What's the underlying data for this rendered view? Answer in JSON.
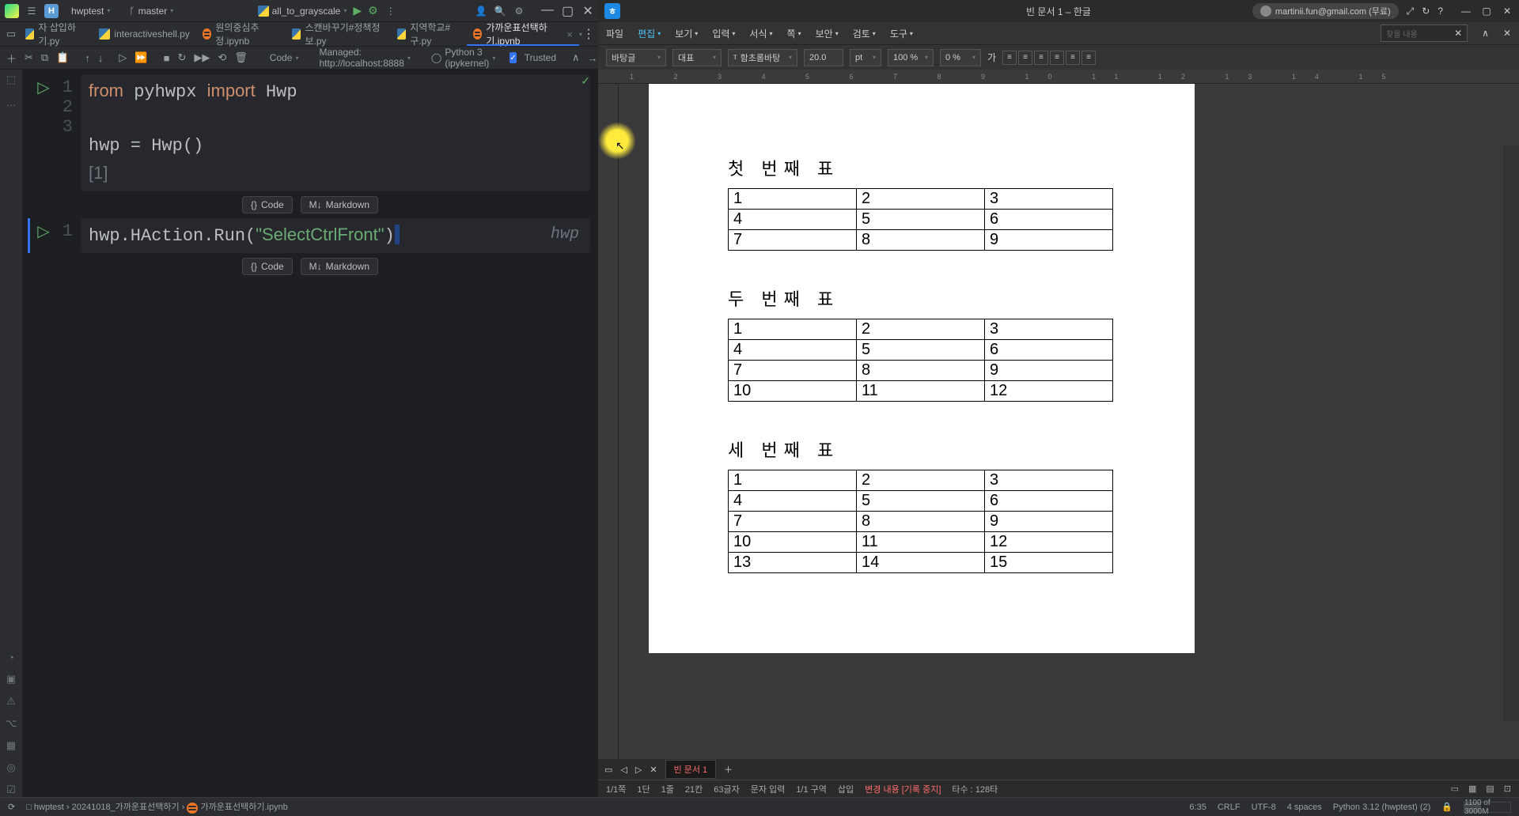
{
  "pycharm": {
    "project_badge": "H",
    "project_name": "hwptest",
    "branch": "master",
    "run_config": "all_to_grayscale",
    "tabs": [
      {
        "icon": "py",
        "label": "자 삽입하기.py"
      },
      {
        "icon": "py",
        "label": "interactiveshell.py"
      },
      {
        "icon": "jup",
        "label": "원의중심추정.ipynb"
      },
      {
        "icon": "py",
        "label": "스캔바꾸기#정책정보.py"
      },
      {
        "icon": "py",
        "label": "지역학교#구.py"
      },
      {
        "icon": "jup",
        "label": "가까운표선택하기.ipynb",
        "active": true
      }
    ],
    "nb_toolbar": {
      "code_label": "Code",
      "managed": "Managed: http://localhost:8888",
      "kernel": "Python 3 (ipykernel)",
      "trusted": "Trusted"
    },
    "cell1": {
      "lines": [
        {
          "n": "1",
          "tokens": [
            [
              "kw",
              "from"
            ],
            [
              "id",
              " pyhwpx "
            ],
            [
              "kw",
              "import"
            ],
            [
              "id",
              " Hwp"
            ]
          ]
        },
        {
          "n": "2",
          "tokens": []
        },
        {
          "n": "3",
          "tokens": [
            [
              "id",
              "hwp = Hwp()"
            ]
          ]
        }
      ],
      "out": "[1]"
    },
    "cell2": {
      "n": "1",
      "html": "hwp.HAction.Run(<span class='str'>\"SelectCtrlFront\"</span>)",
      "hint": "hwp"
    },
    "add": {
      "code": "Code",
      "md": "Markdown"
    },
    "status": {
      "path1": "hwptest",
      "path2": "20241018_가까운표선택하기",
      "path3": "가까운표선택하기.ipynb",
      "pos": "6:35",
      "eol": "CRLF",
      "enc": "UTF-8",
      "indent": "4 spaces",
      "interp": "Python 3.12 (hwptest) (2)",
      "mem": "1100 of 3000M"
    }
  },
  "hwp": {
    "title": "빈 문서 1 – 한글",
    "account": "martinii.fun@gmail.com (무료)",
    "menu": [
      "파일",
      "편집",
      "보기",
      "입력",
      "서식",
      "쪽",
      "보안",
      "검토",
      "도구"
    ],
    "menu_active_idx": 1,
    "format": {
      "style": "바탕글",
      "rep": "대표",
      "font": "함초롬바탕",
      "size": "20.0",
      "unit": "pt",
      "char_sp": "100 %",
      "line_sp": "0 %",
      "ga": "가"
    },
    "ruler": "1 2 3 4 5 6 7 8 9 10 11 12 13 14 15",
    "sections": [
      {
        "title": "첫 번째 표",
        "rows": [
          [
            "1",
            "2",
            "3"
          ],
          [
            "4",
            "5",
            "6"
          ],
          [
            "7",
            "8",
            "9"
          ]
        ]
      },
      {
        "title": "두 번째 표",
        "rows": [
          [
            "1",
            "2",
            "3"
          ],
          [
            "4",
            "5",
            "6"
          ],
          [
            "7",
            "8",
            "9"
          ],
          [
            "10",
            "11",
            "12"
          ]
        ]
      },
      {
        "title": "세 번째 표",
        "rows": [
          [
            "1",
            "2",
            "3"
          ],
          [
            "4",
            "5",
            "6"
          ],
          [
            "7",
            "8",
            "9"
          ],
          [
            "10",
            "11",
            "12"
          ],
          [
            "13",
            "14",
            "15"
          ]
        ]
      }
    ],
    "doc_tab": "빈 문서 1",
    "status": {
      "page": "1/1쪽",
      "dan": "1단",
      "line": "1줄",
      "col": "21칸",
      "chars": "63글자",
      "mode": "문자 입력",
      "sec": "1/1 구역",
      "ins": "삽입",
      "rec": "변경 내용 [기록 중지]",
      "strokes": "타수 : 128타"
    }
  }
}
